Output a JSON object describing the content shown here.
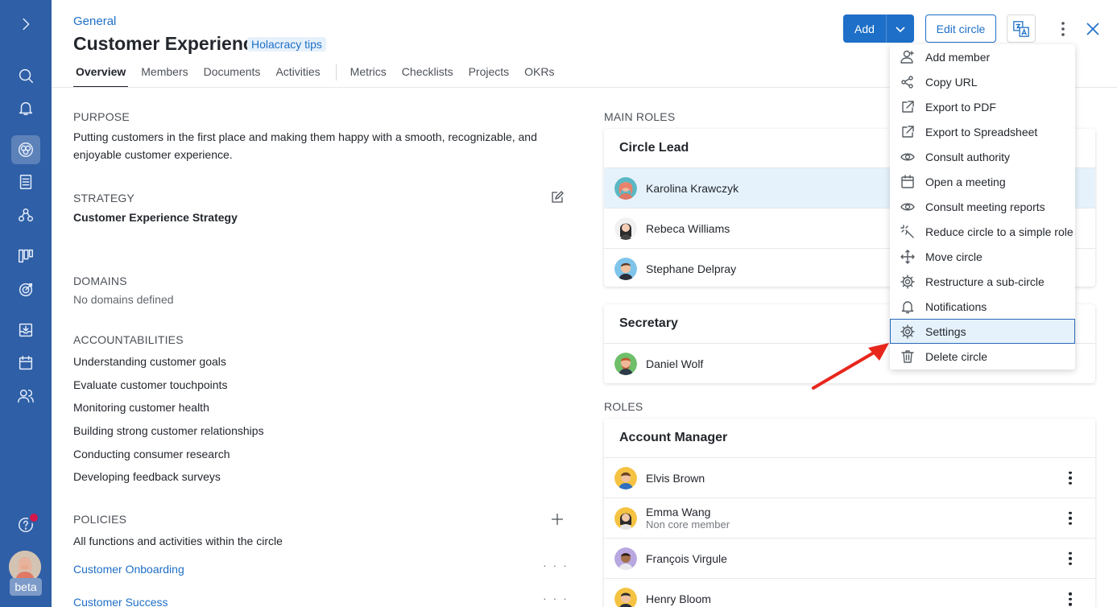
{
  "sidebar": {
    "badge_color": "#d5174b",
    "beta_label": "beta",
    "icons": [
      "expand-icon",
      "search-icon",
      "bell-icon",
      "circles-icon",
      "document-icon",
      "roles-icon",
      "board-icon",
      "target-icon",
      "inbox-icon",
      "calendar-icon",
      "people-icon",
      "help-icon"
    ]
  },
  "header": {
    "breadcrumb": "General",
    "title": "Customer Experience",
    "tips": "Holacracy tips",
    "tabs": [
      "Overview",
      "Members",
      "Documents",
      "Activities",
      "Metrics",
      "Checklists",
      "Projects",
      "OKRs"
    ],
    "add_label": "Add",
    "edit_label": "Edit circle"
  },
  "purpose": {
    "heading": "PURPOSE",
    "text": "Putting customers in the first place and making them happy with a smooth, recognizable, and enjoyable customer experience."
  },
  "strategy": {
    "heading": "STRATEGY",
    "text": "Customer Experience Strategy"
  },
  "domains": {
    "heading": "DOMAINS",
    "text": "No domains defined"
  },
  "accountabilities": {
    "heading": "ACCOUNTABILITIES",
    "items": [
      "Understanding customer goals",
      "Evaluate customer touchpoints",
      "Monitoring customer health",
      "Building strong customer relationships",
      "Conducting consumer research",
      "Developing feedback surveys"
    ]
  },
  "policies": {
    "heading": "POLICIES",
    "text": "All functions and activities within the circle",
    "links": [
      "Customer Onboarding",
      "Customer Success"
    ]
  },
  "main_roles": {
    "heading": "MAIN ROLES",
    "circle_lead": {
      "title": "Circle Lead",
      "members": [
        "Karolina Krawczyk",
        "Rebeca Williams",
        "Stephane Delpray"
      ]
    },
    "secretary": {
      "title": "Secretary",
      "members": [
        "Daniel Wolf"
      ]
    }
  },
  "roles": {
    "heading": "ROLES",
    "account_manager": {
      "title": "Account Manager",
      "members": [
        {
          "name": "Elvis Brown",
          "sub": ""
        },
        {
          "name": "Emma Wang",
          "sub": "Non core member"
        },
        {
          "name": "François Virgule",
          "sub": ""
        },
        {
          "name": "Henry Bloom",
          "sub": ""
        }
      ]
    }
  },
  "menu": {
    "items": [
      "Add member",
      "Copy URL",
      "Export to PDF",
      "Export to Spreadsheet",
      "Consult authority",
      "Open a meeting",
      "Consult meeting reports",
      "Reduce circle to a simple role",
      "Move circle",
      "Restructure a sub-circle",
      "Notifications",
      "Settings",
      "Delete circle"
    ],
    "selected": "Settings"
  },
  "colors": {
    "sidebar": "#2f5fa6",
    "accent": "#1e6fc7",
    "highlight": "#e6f2fb",
    "arrow": "#e8261c"
  }
}
